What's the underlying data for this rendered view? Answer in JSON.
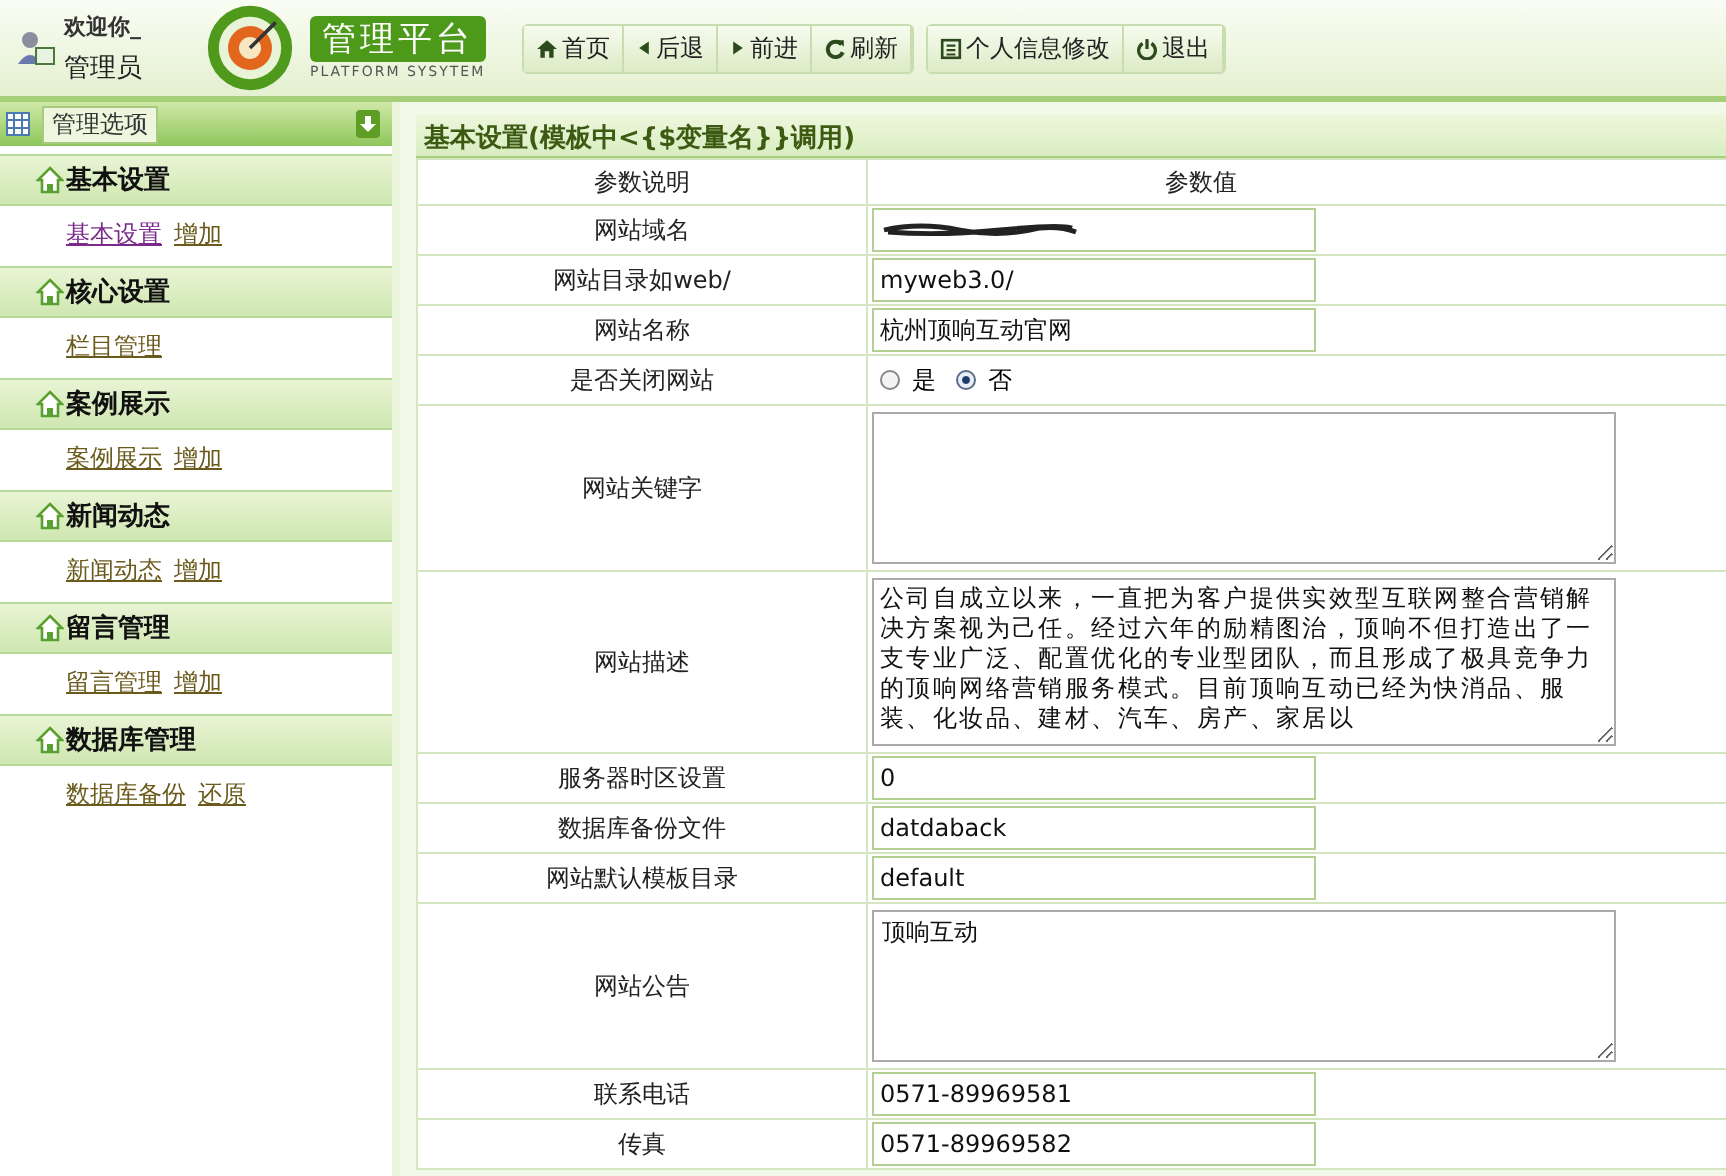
{
  "header": {
    "welcome": "欢迎你_",
    "role": "管理员",
    "logo_title": "管理平台",
    "logo_subtitle": "PLATFORM SYSYTEM",
    "nav": [
      {
        "label": "首页",
        "kind": "home"
      },
      {
        "label": "后退",
        "kind": "back"
      },
      {
        "label": "前进",
        "kind": "forward"
      },
      {
        "label": "刷新",
        "kind": "refresh"
      }
    ],
    "user_nav": [
      {
        "label": "个人信息修改",
        "kind": "profile"
      },
      {
        "label": "退出",
        "kind": "power"
      }
    ]
  },
  "sidebar": {
    "title": "管理选项",
    "sections": [
      {
        "title": "基本设置",
        "links": [
          {
            "label": "基本设置",
            "visited": true
          },
          {
            "label": "增加",
            "visited": false
          }
        ]
      },
      {
        "title": "核心设置",
        "links": [
          {
            "label": "栏目管理",
            "visited": false
          }
        ]
      },
      {
        "title": "案例展示",
        "links": [
          {
            "label": "案例展示",
            "visited": false
          },
          {
            "label": "增加",
            "visited": false
          }
        ]
      },
      {
        "title": "新闻动态",
        "links": [
          {
            "label": "新闻动态",
            "visited": false
          },
          {
            "label": "增加",
            "visited": false
          }
        ]
      },
      {
        "title": "留言管理",
        "links": [
          {
            "label": "留言管理",
            "visited": false
          },
          {
            "label": "增加",
            "visited": false
          }
        ]
      },
      {
        "title": "数据库管理",
        "links": [
          {
            "label": "数据库备份",
            "visited": false
          },
          {
            "label": "还原",
            "visited": false
          }
        ]
      }
    ]
  },
  "main": {
    "title": "基本设置(模板中<{$变量名}}调用)",
    "columns": [
      "参数说明",
      "参数值"
    ],
    "rows": [
      {
        "label": "网站域名",
        "kind": "redacted"
      },
      {
        "label": "网站目录如web/",
        "kind": "input",
        "value": "myweb3.0/"
      },
      {
        "label": "网站名称",
        "kind": "input",
        "value": "杭州顶响互动官网"
      },
      {
        "label": "是否关闭网站",
        "kind": "radio",
        "options": [
          {
            "label": "是",
            "selected": false
          },
          {
            "label": "否",
            "selected": true
          }
        ]
      },
      {
        "label": "网站关键字",
        "kind": "textarea"
      },
      {
        "label": "网站描述",
        "kind": "textarea",
        "value": "公司自成立以来，一直把为客户提供实效型互联网整合营销解决方案视为己任。经过六年的励精图治，顶响不但打造出了一支专业广泛、配置优化的专业型团队，而且形成了极具竞争力的顶响网络营销服务模式。目前顶响互动已经为快消品、服装、化妆品、建材、汽车、房产、家居以"
      },
      {
        "label": "服务器时区设置",
        "kind": "input",
        "value": "0"
      },
      {
        "label": "数据库备份文件",
        "kind": "input",
        "value": "datdaback"
      },
      {
        "label": "网站默认模板目录",
        "kind": "input",
        "value": "default"
      },
      {
        "label": "网站公告",
        "kind": "textarea",
        "value": "顶响互动"
      },
      {
        "label": "联系电话",
        "kind": "input",
        "value": "0571-89969581"
      },
      {
        "label": "传真",
        "kind": "input",
        "value": "0571-89969582"
      }
    ]
  }
}
